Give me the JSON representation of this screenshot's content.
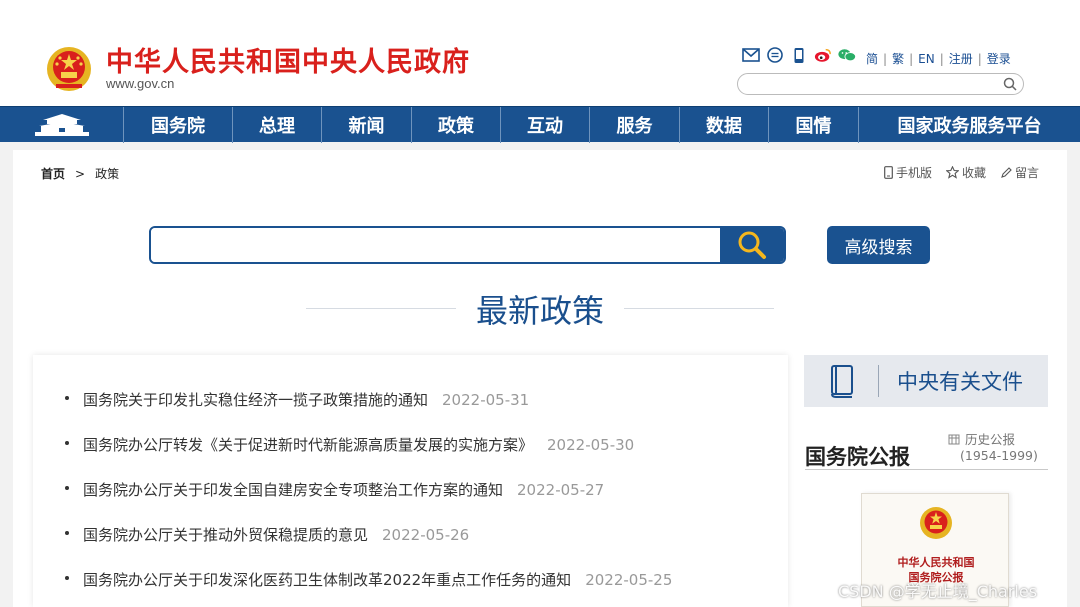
{
  "header": {
    "title": "中华人民共和国中央人民政府",
    "domain": "www.gov.cn",
    "icons": [
      "mail-icon",
      "chat-icon",
      "mobile-icon",
      "weibo-icon",
      "wechat-icon"
    ],
    "links": [
      "简",
      "繁",
      "EN",
      "注册",
      "登录"
    ],
    "search_placeholder": ""
  },
  "nav": {
    "items": [
      "国务院",
      "总理",
      "新闻",
      "政策",
      "互动",
      "服务",
      "数据",
      "国情",
      "国家政务服务平台"
    ],
    "color": "#1a5290"
  },
  "breadcrumb": {
    "home": "首页",
    "separator": ">",
    "current": "政策"
  },
  "utilities": {
    "mobile": "手机版",
    "favorite": "收藏",
    "message": "留言"
  },
  "search": {
    "placeholder": "",
    "advanced_label": "高级搜索"
  },
  "section": {
    "title": "最新政策"
  },
  "policies": [
    {
      "title": "国务院关于印发扎实稳住经济一揽子政策措施的通知",
      "date": "2022-05-31"
    },
    {
      "title": "国务院办公厅转发《关于促进新时代新能源高质量发展的实施方案》",
      "date": "2022-05-30"
    },
    {
      "title": "国务院办公厅关于印发全国自建房安全专项整治工作方案的通知",
      "date": "2022-05-27"
    },
    {
      "title": "国务院办公厅关于推动外贸保稳提质的意见",
      "date": "2022-05-26"
    },
    {
      "title": "国务院办公厅关于印发深化医药卫生体制改革2022年重点工作任务的通知",
      "date": "2022-05-25"
    }
  ],
  "sidebar": {
    "documents_label": "中央有关文件",
    "gazette_title": "国务院公报",
    "gazette_history": "历史公报",
    "gazette_years": "(1954-1999)",
    "gazette_cover_line1": "中华人民共和国",
    "gazette_cover_line2": "国务院公报"
  },
  "watermark": "CSDN @学无止境_Charles",
  "colors": {
    "brand_red": "#d9201c",
    "brand_blue": "#1a5290"
  }
}
